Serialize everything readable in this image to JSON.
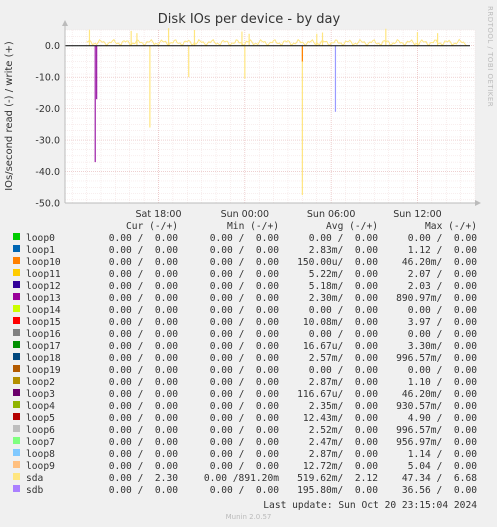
{
  "chart_data": {
    "type": "line",
    "title": "Disk IOs per device - by day",
    "ylabel": "IOs/second read (-) / write (+)",
    "xlabel": "",
    "ylim": [
      -50,
      5
    ],
    "yticks": [
      0.0,
      -10.0,
      -20.0,
      -30.0,
      -40.0,
      -50.0
    ],
    "ytick_labels": [
      "0.0",
      "-10.0",
      "-20.0",
      "-30.0",
      "-40.0",
      "-50.0"
    ],
    "xlim_hours": [
      11.5,
      40.0
    ],
    "xtick_hours": [
      18,
      24,
      30,
      36,
      42
    ],
    "xtick_labels": [
      "Sat 18:00",
      "Sun 00:00",
      "Sun 06:00",
      "Sun 12:00",
      "Sun 18:00"
    ],
    "grid": true,
    "series": [
      {
        "name": "sda",
        "color": "#FFE680",
        "spikes": [
          [
            13.2,
            5.1
          ],
          [
            16.1,
            4.7
          ],
          [
            16.5,
            4.0
          ],
          [
            17.4,
            -26.0
          ],
          [
            18.7,
            5.6
          ],
          [
            20.1,
            -10.0
          ],
          [
            20.5,
            5.0
          ],
          [
            23.8,
            4.5
          ],
          [
            24.0,
            -10.5
          ],
          [
            24.3,
            3.8
          ],
          [
            28.0,
            -47.5
          ],
          [
            29.0,
            3.8
          ],
          [
            29.4,
            4.2
          ],
          [
            33.8,
            5.4
          ],
          [
            36.0,
            4.3
          ],
          [
            37.4,
            4.0
          ],
          [
            41.6,
            4.3
          ]
        ],
        "baseline": 1.0
      },
      {
        "name": "loop13",
        "color": "#9A1AA6",
        "spikes": [
          [
            13.6,
            -37.0
          ],
          [
            13.7,
            -17.0
          ]
        ],
        "baseline": 0.0
      },
      {
        "name": "loop10",
        "color": "#FF8000",
        "spikes": [
          [
            28.0,
            -5.0
          ]
        ],
        "baseline": 0.0
      },
      {
        "name": "sdb",
        "color": "#9999FF",
        "spikes": [
          [
            30.3,
            -21.0
          ]
        ],
        "baseline": 0.0
      },
      {
        "name": "loop0",
        "color": "#000000",
        "spikes": [],
        "baseline": 0.0
      }
    ]
  },
  "side_credit": "RRDTOOL / TOBI OETIKER",
  "legend": {
    "headers": {
      "cur": "Cur (-/+)",
      "min": "Min (-/+)",
      "avg": "Avg (-/+)",
      "max": "Max (-/+)"
    },
    "rows": [
      {
        "name": "loop0",
        "color": "#00CC00",
        "cur": "0.00 /  0.00",
        "min": "0.00 /  0.00",
        "avg": "0.00 /  0.00",
        "max": "0.00 /  0.00"
      },
      {
        "name": "loop1",
        "color": "#0066B3",
        "cur": "0.00 /  0.00",
        "min": "0.00 /  0.00",
        "avg": "2.83m/  0.00",
        "max": "1.12 /  0.00"
      },
      {
        "name": "loop10",
        "color": "#FF8000",
        "cur": "0.00 /  0.00",
        "min": "0.00 /  0.00",
        "avg": "150.00u/  0.00",
        "max": "46.20m/  0.00"
      },
      {
        "name": "loop11",
        "color": "#FFCC00",
        "cur": "0.00 /  0.00",
        "min": "0.00 /  0.00",
        "avg": "5.22m/  0.00",
        "max": "2.07 /  0.00"
      },
      {
        "name": "loop12",
        "color": "#330099",
        "cur": "0.00 /  0.00",
        "min": "0.00 /  0.00",
        "avg": "5.18m/  0.00",
        "max": "2.03 /  0.00"
      },
      {
        "name": "loop13",
        "color": "#990099",
        "cur": "0.00 /  0.00",
        "min": "0.00 /  0.00",
        "avg": "2.30m/  0.00",
        "max": "890.97m/  0.00"
      },
      {
        "name": "loop14",
        "color": "#CCFF00",
        "cur": "0.00 /  0.00",
        "min": "0.00 /  0.00",
        "avg": "0.00 /  0.00",
        "max": "0.00 /  0.00"
      },
      {
        "name": "loop15",
        "color": "#FF0000",
        "cur": "0.00 /  0.00",
        "min": "0.00 /  0.00",
        "avg": "10.08m/  0.00",
        "max": "3.97 /  0.00"
      },
      {
        "name": "loop16",
        "color": "#808080",
        "cur": "0.00 /  0.00",
        "min": "0.00 /  0.00",
        "avg": "0.00 /  0.00",
        "max": "0.00 /  0.00"
      },
      {
        "name": "loop17",
        "color": "#008F00",
        "cur": "0.00 /  0.00",
        "min": "0.00 /  0.00",
        "avg": "16.67u/  0.00",
        "max": "3.30m/  0.00"
      },
      {
        "name": "loop18",
        "color": "#00487D",
        "cur": "0.00 /  0.00",
        "min": "0.00 /  0.00",
        "avg": "2.57m/  0.00",
        "max": "996.57m/  0.00"
      },
      {
        "name": "loop19",
        "color": "#B35A00",
        "cur": "0.00 /  0.00",
        "min": "0.00 /  0.00",
        "avg": "0.00 /  0.00",
        "max": "0.00 /  0.00"
      },
      {
        "name": "loop2",
        "color": "#B38F00",
        "cur": "0.00 /  0.00",
        "min": "0.00 /  0.00",
        "avg": "2.87m/  0.00",
        "max": "1.10 /  0.00"
      },
      {
        "name": "loop3",
        "color": "#6B006B",
        "cur": "0.00 /  0.00",
        "min": "0.00 /  0.00",
        "avg": "116.67u/  0.00",
        "max": "46.20m/  0.00"
      },
      {
        "name": "loop4",
        "color": "#8FB300",
        "cur": "0.00 /  0.00",
        "min": "0.00 /  0.00",
        "avg": "2.35m/  0.00",
        "max": "930.57m/  0.00"
      },
      {
        "name": "loop5",
        "color": "#B30000",
        "cur": "0.00 /  0.00",
        "min": "0.00 /  0.00",
        "avg": "12.43m/  0.00",
        "max": "4.90 /  0.00"
      },
      {
        "name": "loop6",
        "color": "#BEBEBE",
        "cur": "0.00 /  0.00",
        "min": "0.00 /  0.00",
        "avg": "2.52m/  0.00",
        "max": "996.57m/  0.00"
      },
      {
        "name": "loop7",
        "color": "#80FF80",
        "cur": "0.00 /  0.00",
        "min": "0.00 /  0.00",
        "avg": "2.47m/  0.00",
        "max": "956.97m/  0.00"
      },
      {
        "name": "loop8",
        "color": "#80C9FF",
        "cur": "0.00 /  0.00",
        "min": "0.00 /  0.00",
        "avg": "2.87m/  0.00",
        "max": "1.14 /  0.00"
      },
      {
        "name": "loop9",
        "color": "#FFC080",
        "cur": "0.00 /  0.00",
        "min": "0.00 /  0.00",
        "avg": "12.72m/  0.00",
        "max": "5.04 /  0.00"
      },
      {
        "name": "sda",
        "color": "#FFE680",
        "cur": "0.00 /  2.30",
        "min": "0.00 /891.20m",
        "avg": "519.62m/  2.12",
        "max": "47.34 /  6.68"
      },
      {
        "name": "sdb",
        "color": "#AA80FF",
        "cur": "0.00 /  0.00",
        "min": "0.00 /  0.00",
        "avg": "195.80m/  0.00",
        "max": "36.56 /  0.00"
      }
    ]
  },
  "last_update": "Last update: Sun Oct 20 23:15:04 2024",
  "munin_version": "Munin 2.0.57"
}
